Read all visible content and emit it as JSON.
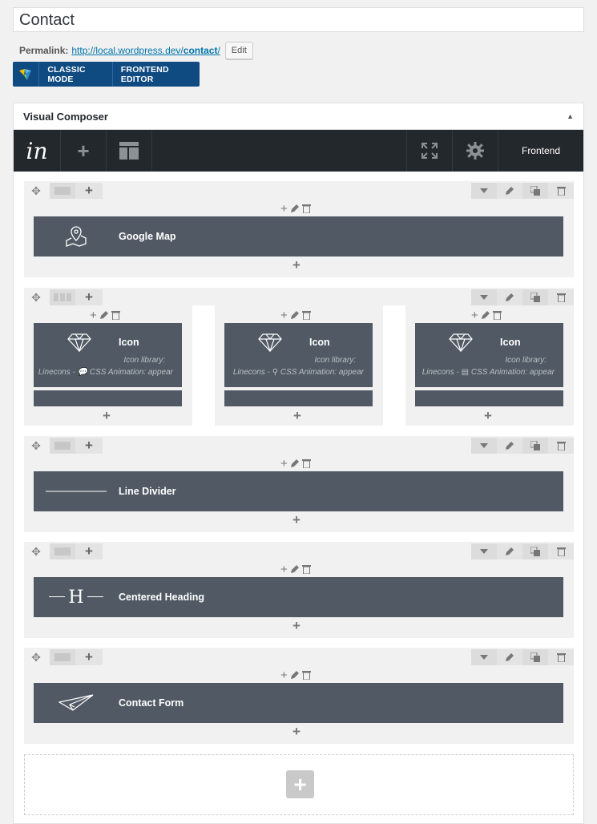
{
  "post": {
    "title": "Contact",
    "permalink_label": "Permalink:",
    "permalink_base": "http://local.wordpress.dev/",
    "permalink_slug": "contact",
    "permalink_trail": "/",
    "edit_label": "Edit"
  },
  "modes": {
    "classic_label": "CLASSIC MODE",
    "frontend_label": "FRONTEND EDITOR"
  },
  "panel": {
    "title": "Visual Composer",
    "toggle_glyph": "▲",
    "brand": "in",
    "frontend_label": "Frontend"
  },
  "rows": [
    {
      "element": "Google Map"
    },
    {
      "columns": [
        {
          "name": "Icon",
          "library": "Icon library:",
          "detail": "Linecons - 💬 CSS Animation: appear"
        },
        {
          "name": "Icon",
          "library": "Icon library:",
          "detail": "Linecons - ⚲ CSS Animation: appear"
        },
        {
          "name": "Icon",
          "library": "Icon library:",
          "detail": "Linecons - ▤ CSS Animation: appear"
        }
      ]
    },
    {
      "element": "Line Divider"
    },
    {
      "element": "Centered Heading"
    },
    {
      "element": "Contact Form"
    }
  ],
  "glyphs": {
    "plus": "+",
    "heading_h": "H",
    "move": "✥"
  },
  "colors": {
    "element_bg": "#515a64",
    "navbar_bg": "#23282d",
    "mode_bar": "#0f4a80",
    "link": "#0073aa"
  }
}
